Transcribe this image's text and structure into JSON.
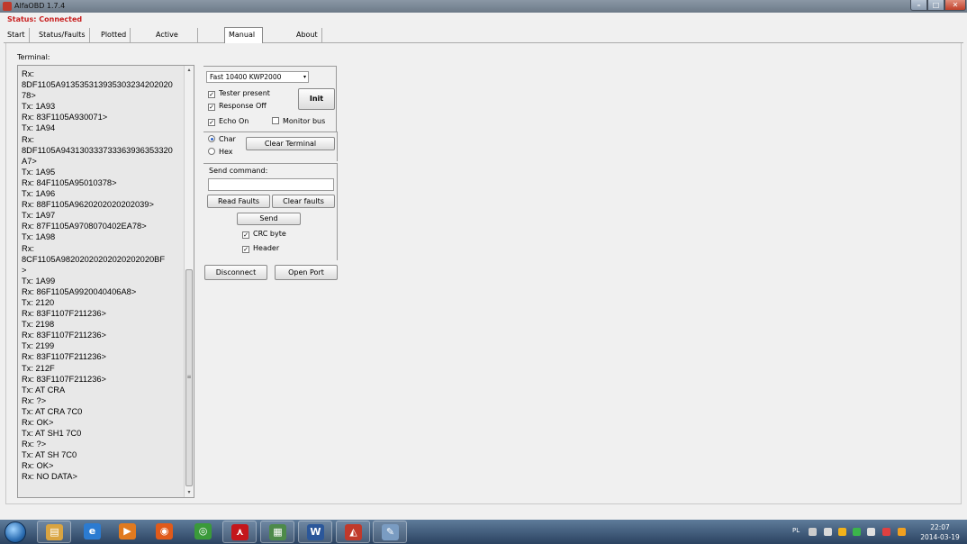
{
  "window": {
    "title": "AlfaOBD 1.7.4",
    "controls": {
      "minimize": "–",
      "maximize": "□",
      "close": "✕"
    }
  },
  "status": "Status: Connected",
  "tabs": [
    {
      "label": "Start",
      "active": false
    },
    {
      "label": "Status/Faults",
      "active": false
    },
    {
      "label": "Plotted Data",
      "active": false
    },
    {
      "label": "Active Diagnostic",
      "active": false
    },
    {
      "label": "Manual Connect",
      "active": true
    },
    {
      "label": "About",
      "active": false
    }
  ],
  "terminal": {
    "label": "Terminal:",
    "text": "Rx:\n8DF1105A913535313935303234202020\n78>\nTx: 1A93\nRx: 83F1105A930071>\nTx: 1A94\nRx:\n8DF1105A943130333733363936353320\nA7>\nTx: 1A95\nRx: 84F1105A95010378>\nTx: 1A96\nRx: 88F1105A9620202020202039>\nTx: 1A97\nRx: 87F1105A9708070402EA78>\nTx: 1A98\nRx:\n8CF1105A98202020202020202020BF\n>\nTx: 1A99\nRx: 86F1105A9920040406A8>\nTx: 2120\nRx: 83F1107F211236>\nTx: 2198\nRx: 83F1107F211236>\nTx: 2199\nRx: 83F1107F211236>\nTx: 212F\nRx: 83F1107F211236>\nTx: AT CRA\nRx: ?>\nTx: AT CRA 7C0\nRx: OK>\nTx: AT SH1 7C0\nRx: ?>\nTx: AT SH 7C0\nRx: OK>\nRx: NO DATA>",
    "scroll_up": "▴",
    "scroll_down": "▾",
    "scroll_grip": "≡"
  },
  "protocol": {
    "selected": "Fast 10400 KWP2000",
    "arrow": "▾",
    "tester_present": {
      "label": "Tester present",
      "checked": true
    },
    "response_off": {
      "label": "Response Off",
      "checked": true
    },
    "echo_on": {
      "label": "Echo On",
      "checked": true
    },
    "monitor_bus": {
      "label": "Monitor bus",
      "checked": false
    },
    "init_label": "Init"
  },
  "mode": {
    "char": {
      "label": "Char",
      "selected": true
    },
    "hex": {
      "label": "Hex",
      "selected": false
    },
    "clear_terminal_label": "Clear Terminal"
  },
  "send": {
    "label": "Send command:",
    "value": "",
    "read_faults_label": "Read Faults",
    "clear_faults_label": "Clear faults",
    "send_label": "Send",
    "crc_byte": {
      "label": "CRC byte",
      "checked": true
    },
    "header": {
      "label": "Header",
      "checked": true
    }
  },
  "connection": {
    "disconnect_label": "Disconnect",
    "open_port_label": "Open Port"
  },
  "taskbar": {
    "buttons": [
      {
        "name": "explorer",
        "glyph": "▤",
        "color": "#d9a441",
        "open": true
      },
      {
        "name": "internet-explorer",
        "glyph": "e",
        "color": "#2b7bd1",
        "open": false
      },
      {
        "name": "media-player",
        "glyph": "▶",
        "color": "#e07a1f",
        "open": false
      },
      {
        "name": "firefox",
        "glyph": "◉",
        "color": "#e05a1a",
        "open": false
      },
      {
        "name": "chrome",
        "glyph": "◎",
        "color": "#3a9a3a",
        "open": false
      },
      {
        "name": "acrobat",
        "glyph": "⋏",
        "color": "#c4161c",
        "open": true
      },
      {
        "name": "remote-app",
        "glyph": "▦",
        "color": "#4d8a4a",
        "open": true
      },
      {
        "name": "word",
        "glyph": "W",
        "color": "#2b579a",
        "open": true
      },
      {
        "name": "alfaobd",
        "glyph": "◭",
        "color": "#c0392b",
        "open": true
      },
      {
        "name": "paint",
        "glyph": "✎",
        "color": "#7a9cc2",
        "open": true
      }
    ],
    "language": "PL",
    "time": "22:07",
    "date": "2014-03-19"
  }
}
